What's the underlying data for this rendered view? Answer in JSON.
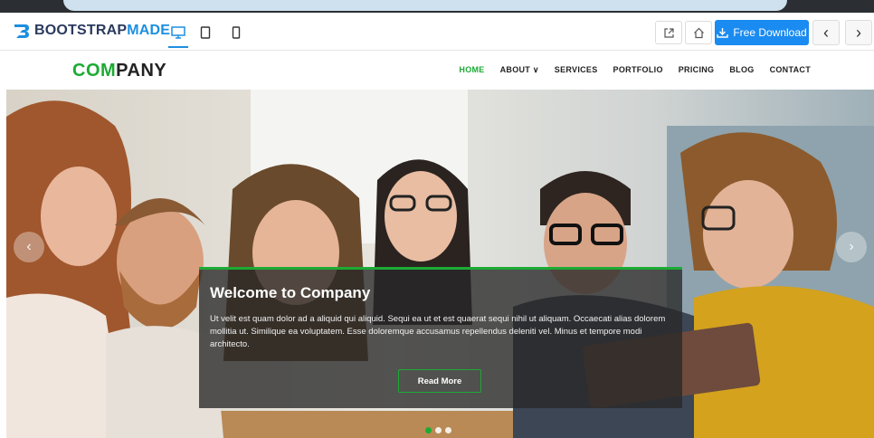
{
  "toolbar": {
    "brand_part1": "BOOTSTRAP",
    "brand_part2": "MADE",
    "devices": [
      {
        "icon": "desktop-icon",
        "active": true
      },
      {
        "icon": "tablet-icon",
        "active": false
      },
      {
        "icon": "phone-icon",
        "active": false
      }
    ],
    "download_label": "Free Download",
    "colors": {
      "accent": "#1a8bf0",
      "brand_dark": "#2a3a5e"
    }
  },
  "site": {
    "brand_part1": "COM",
    "brand_part2": "PANY",
    "menu": [
      {
        "label": "HOME",
        "active": true
      },
      {
        "label": "ABOUT ∨",
        "active": false
      },
      {
        "label": "SERVICES",
        "active": false
      },
      {
        "label": "PORTFOLIO",
        "active": false
      },
      {
        "label": "PRICING",
        "active": false
      },
      {
        "label": "BLOG",
        "active": false
      },
      {
        "label": "CONTACT",
        "active": false
      }
    ],
    "colors": {
      "accent": "#1cab34"
    }
  },
  "hero": {
    "title": "Welcome to Company",
    "text": "Ut velit est quam dolor ad a aliquid qui aliquid. Sequi ea ut et est quaerat sequi nihil ut aliquam. Occaecati alias dolorem mollitia ut. Similique ea voluptatem. Esse doloremque accusamus repellendus deleniti vel. Minus et tempore modi architecto.",
    "button": "Read More",
    "slide_count": 3,
    "active_slide": 1
  }
}
